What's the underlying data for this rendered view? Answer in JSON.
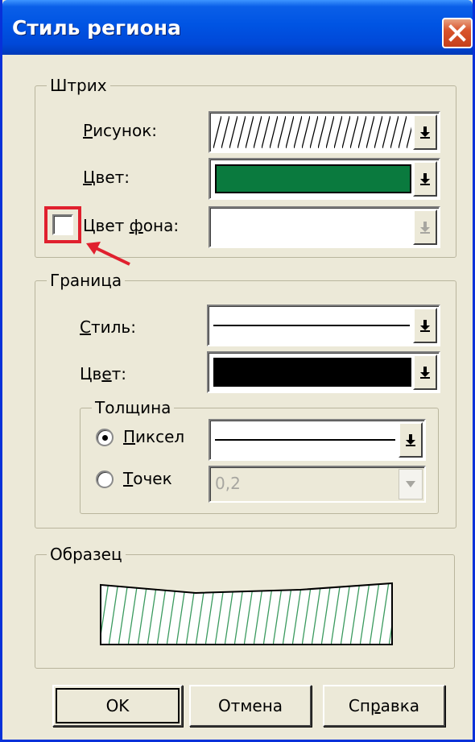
{
  "window": {
    "title": "Стиль региона"
  },
  "stroke": {
    "legend": "Штрих",
    "pattern_label_u": "Р",
    "pattern_label_rest": "исунок:",
    "color_label_u": "Ц",
    "color_label_rest": "вет:",
    "bg_color_label_a": "Цвет ",
    "bg_color_label_u": "ф",
    "bg_color_label_b": "она:",
    "color_value": "#0a7a3e",
    "bg_checkbox_checked": false
  },
  "border": {
    "legend": "Граница",
    "style_label_u": "С",
    "style_label_rest": "тиль:",
    "color_label_a": "Цв",
    "color_label_u": "е",
    "color_label_b": "т:",
    "color_value": "#000000",
    "thickness": {
      "legend": "Толщина",
      "pixel_label_u": "П",
      "pixel_label_rest": "иксел",
      "points_label_u": "Т",
      "points_label_rest": "очек",
      "points_value": "0,2",
      "selected": "pixel"
    }
  },
  "sample": {
    "legend": "Образец",
    "fill_color": "#3a9a5e"
  },
  "buttons": {
    "ok": "OK",
    "cancel": "Отмена",
    "help_a": "Сп",
    "help_u": "р",
    "help_b": "авка"
  },
  "colors": {
    "titlebar": "#0054e3",
    "highlight": "#e0202e"
  }
}
